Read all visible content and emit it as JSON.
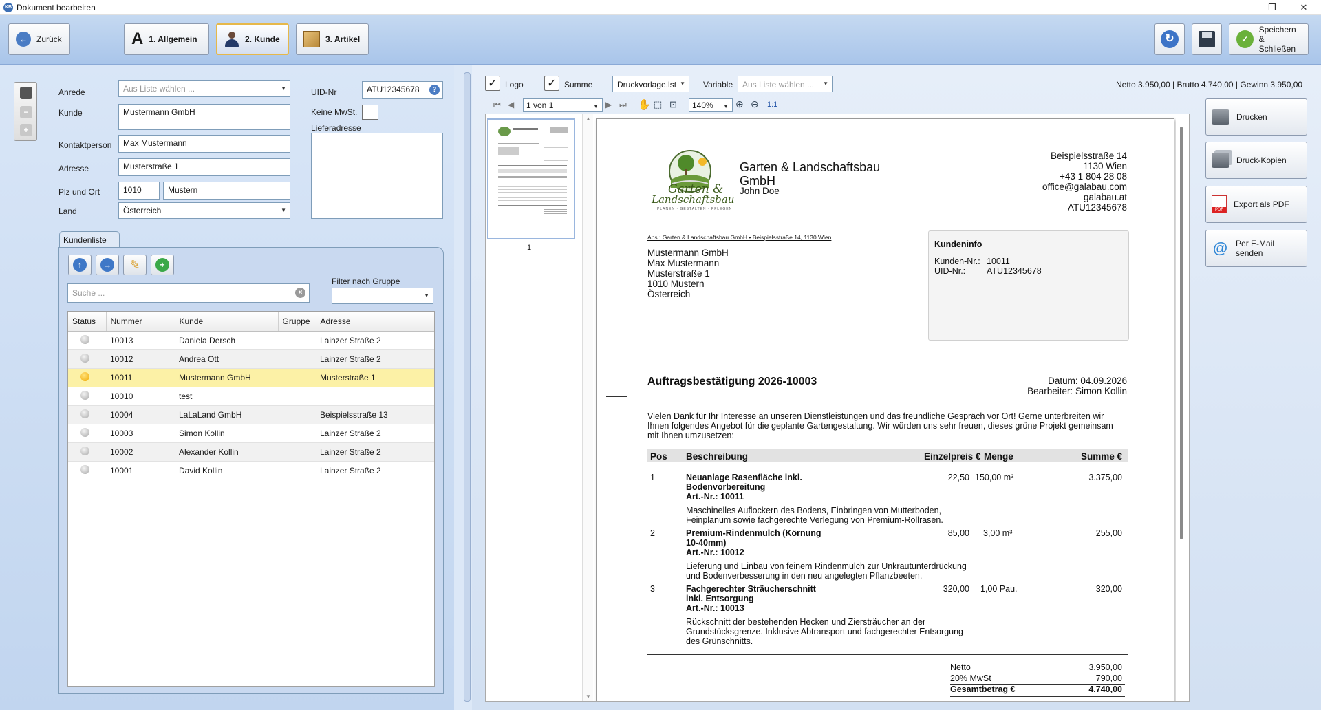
{
  "window": {
    "title": "Dokument bearbeiten",
    "app_icon": "KB"
  },
  "toolbar": {
    "back_label": "Zurück",
    "tabs": [
      {
        "num": "1.",
        "label": "Allgemein"
      },
      {
        "num": "2.",
        "label": "Kunde"
      },
      {
        "num": "3.",
        "label": "Artikel"
      }
    ],
    "save_close_line1": "Speichern",
    "save_close_line2": "& Schließen"
  },
  "customer_form": {
    "anrede_label": "Anrede",
    "anrede_placeholder": "Aus Liste wählen ...",
    "kunde_label": "Kunde",
    "kunde_value": "Mustermann GmbH",
    "kontakt_label": "Kontaktperson",
    "kontakt_value": "Max Mustermann",
    "adresse_label": "Adresse",
    "adresse_value": "Musterstraße 1",
    "plz_label": "Plz und Ort",
    "plz_value": "1010",
    "ort_value": "Mustern",
    "land_label": "Land",
    "land_value": "Österreich",
    "uid_label": "UID-Nr",
    "uid_value": "ATU12345678",
    "keine_mwst_label": "Keine MwSt.",
    "lieferadresse_label": "Lieferadresse"
  },
  "kundenliste": {
    "tab_label": "Kundenliste",
    "search_placeholder": "Suche ...",
    "filter_label": "Filter nach Gruppe",
    "columns": [
      "Status",
      "Nummer",
      "Kunde",
      "Gruppe",
      "Adresse"
    ],
    "rows": [
      {
        "nummer": "10013",
        "kunde": "Daniela Dersch",
        "gruppe": "",
        "adresse": "Lainzer Straße 2",
        "selected": false
      },
      {
        "nummer": "10012",
        "kunde": "Andrea Ott",
        "gruppe": "",
        "adresse": "Lainzer Straße  2",
        "selected": false
      },
      {
        "nummer": "10011",
        "kunde": "Mustermann GmbH",
        "gruppe": "",
        "adresse": "Musterstraße 1",
        "selected": true
      },
      {
        "nummer": "10010",
        "kunde": "test",
        "gruppe": "",
        "adresse": "",
        "selected": false
      },
      {
        "nummer": "10004",
        "kunde": "LaLaLand GmbH",
        "gruppe": "",
        "adresse": "Beispielsstraße 13",
        "selected": false
      },
      {
        "nummer": "10003",
        "kunde": "Simon Kollin",
        "gruppe": "",
        "adresse": "Lainzer Straße 2",
        "selected": false
      },
      {
        "nummer": "10002",
        "kunde": "Alexander Kollin",
        "gruppe": "",
        "adresse": "Lainzer Straße 2",
        "selected": false
      },
      {
        "nummer": "10001",
        "kunde": "David Kollin",
        "gruppe": "",
        "adresse": "Lainzer Straße 2",
        "selected": false
      }
    ]
  },
  "preview_toolbar": {
    "logo_label": "Logo",
    "summe_label": "Summe",
    "template_value": "Druckvorlage.lst",
    "variable_label": "Variable",
    "variable_placeholder": "Aus Liste wählen ...",
    "summary": "Netto 3.950,00 | Brutto 4.740,00 | Gewinn 3.950,00",
    "page_value": "1 von 1",
    "zoom_value": "140%",
    "ratio_label": "1:1",
    "thumb_page_num": "1"
  },
  "document": {
    "logo_line1": "Garten &",
    "logo_line2": "Landschaftsbau",
    "logo_tagline": "PLANEN · GESTALTEN · PFLEGEN",
    "company_line1": "Garten & Landschaftsbau",
    "company_line2": "GmbH",
    "company_person": "John Doe",
    "sender_address": [
      "Beispielsstraße 14",
      "1130 Wien",
      "+43 1 804 28 08",
      "office@galabau.com",
      "galabau.at",
      "ATU12345678"
    ],
    "sender_line": "Abs.: Garten & Landschaftsbau GmbH • Beispielsstraße 14, 1130 Wien",
    "recipient": [
      "Mustermann GmbH",
      "Max Mustermann",
      "Musterstraße 1",
      "1010 Mustern",
      "Österreich"
    ],
    "info_title": "Kundeninfo",
    "info_kdnr_label": "Kunden-Nr.:",
    "info_kdnr_value": "10011",
    "info_uid_label": "UID-Nr.:",
    "info_uid_value": "ATU12345678",
    "doc_title": "Auftragsbestätigung 2026-10003",
    "datum": "Datum: 04.09.2026",
    "bearbeiter": "Bearbeiter: Simon Kollin",
    "intro": [
      "Vielen Dank für Ihr Interesse an unseren Dienstleistungen und das freundliche Gespräch vor Ort! Gerne unterbreiten wir",
      "Ihnen folgendes Angebot für die geplante Gartengestaltung. Wir würden uns sehr freuen, dieses grüne Projekt gemeinsam",
      "mit Ihnen umzusetzen:"
    ],
    "table_headers": {
      "pos": "Pos",
      "beschreibung": "Beschreibung",
      "einzelpreis": "Einzelpreis €",
      "menge": "Menge",
      "summe": "Summe €"
    },
    "items": [
      {
        "pos": "1",
        "title": [
          "Neuanlage Rasenfläche inkl.",
          "Bodenvorbereitung",
          "Art.-Nr.: 10011"
        ],
        "desc": [
          "Maschinelles Auflockern des Bodens, Einbringen von Mutterboden,",
          "Feinplanum sowie fachgerechte Verlegung von Premium-Rollrasen."
        ],
        "preis": "22,50",
        "menge": "150,00 m²",
        "summe": "3.375,00"
      },
      {
        "pos": "2",
        "title": [
          "Premium-Rindenmulch (Körnung",
          "10-40mm)",
          "Art.-Nr.: 10012"
        ],
        "desc": [
          "Lieferung und Einbau von feinem Rindenmulch zur Unkrautunterdrückung",
          "und Bodenverbesserung in den neu angelegten Pflanzbeeten."
        ],
        "preis": "85,00",
        "menge": "3,00 m³",
        "summe": "255,00"
      },
      {
        "pos": "3",
        "title": [
          "Fachgerechter Sträucherschnitt",
          "inkl. Entsorgung",
          "Art.-Nr.: 10013"
        ],
        "desc": [
          "Rückschnitt der bestehenden Hecken und Ziersträucher an der",
          "Grundstücksgrenze. Inklusive Abtransport und fachgerechter Entsorgung",
          "des Grünschnitts."
        ],
        "preis": "320,00",
        "menge": "1,00 Pau.",
        "summe": "320,00"
      }
    ],
    "totals": [
      {
        "label": "Netto",
        "value": "3.950,00"
      },
      {
        "label": "20% MwSt",
        "value": "790,00"
      },
      {
        "label": "Gesamtbetrag €",
        "value": "4.740,00"
      }
    ]
  },
  "actions": {
    "drucken": "Drucken",
    "druck_kopien": "Druck-Kopien",
    "export_pdf": "Export als PDF",
    "email": "Per E-Mail senden"
  }
}
